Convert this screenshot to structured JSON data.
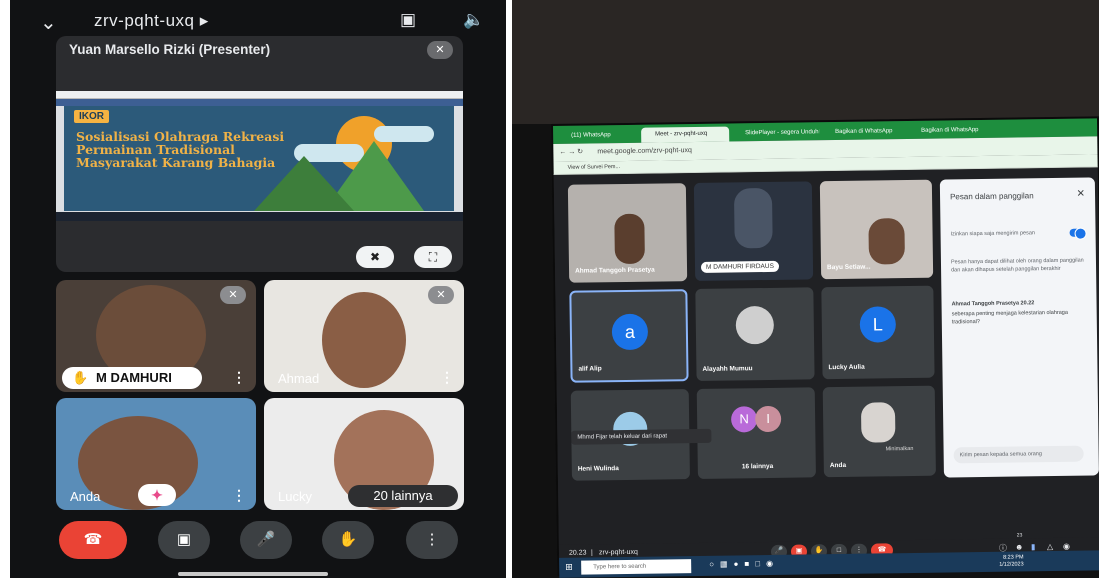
{
  "phone": {
    "meeting_code": "zrv-pqht-uxq",
    "presenter_label": "Yuan Marsello Rizki (Presenter)",
    "slide": {
      "badge": "IKOR",
      "title": "Sosialisasi Olahraga Rekreasi Permainan Tradisional Masyarakat Karang Bahagia"
    },
    "participants": [
      {
        "name": "M DAMHURI",
        "hand_raised": true
      },
      {
        "name": "Ahmad"
      },
      {
        "name": "Anda"
      },
      {
        "name": "Lucky"
      }
    ],
    "more_label": "20 lainnya",
    "icons": [
      "chevron-down-icon",
      "camera-flip-icon",
      "speaker-icon",
      "mic-off-icon",
      "pin-off-icon",
      "fullscreen-icon",
      "more-vert-icon",
      "sparkle-icon",
      "end-call-icon",
      "video-icon",
      "mic-icon",
      "raise-hand-icon"
    ],
    "colors": {
      "end_call": "#ea4335",
      "background": "#111214"
    }
  },
  "laptop": {
    "browser_tabs": [
      "(11) WhatsApp",
      "Meet - zrv-pqht-uxq",
      "SlidePlayer - segera Unduh!",
      "Bagikan di WhatsApp",
      "Bagikan di WhatsApp"
    ],
    "url": "meet.google.com/zrv-pqht-uxq",
    "bookmark": "View of Survei Pem...",
    "tiles": [
      {
        "name": "Ahmad Tanggoh Prasetya"
      },
      {
        "name": "M DAMHURI FIRDAUS"
      },
      {
        "name": "Bayu Setiaw..."
      },
      {
        "name": "alif Alip",
        "avatar": "a"
      },
      {
        "name": "Alayahh Mumuu"
      },
      {
        "name": "Lucky Aulia",
        "avatar": "L"
      },
      {
        "name": "Heni Wulinda"
      },
      {
        "name": "16 lainnya",
        "avatars": [
          "N",
          "I"
        ]
      },
      {
        "name": "Anda",
        "tag": "Minimalkan"
      }
    ],
    "toast": "Mhmd Fijar telah keluar dari rapat",
    "chat": {
      "title": "Pesan dalam panggilan",
      "allow_label": "Izinkan siapa saja mengirim pesan",
      "notice": "Pesan hanya dapat dilihat oleh orang dalam panggilan dan akan dihapus setelah panggilan berakhir",
      "sender": "Ahmad Tanggoh Prasetya",
      "time": "20.22",
      "message": "seberapa penting menjaga kelestarian olahraga tradisional?",
      "input_placeholder": "Kirim pesan kepada semua orang"
    },
    "footer": {
      "time": "20.23",
      "code": "zrv-pqht-uxq",
      "people_count": "23"
    },
    "taskbar": {
      "search": "Type here to search",
      "clock_time": "8:23 PM",
      "clock_date": "1/12/2023"
    }
  }
}
